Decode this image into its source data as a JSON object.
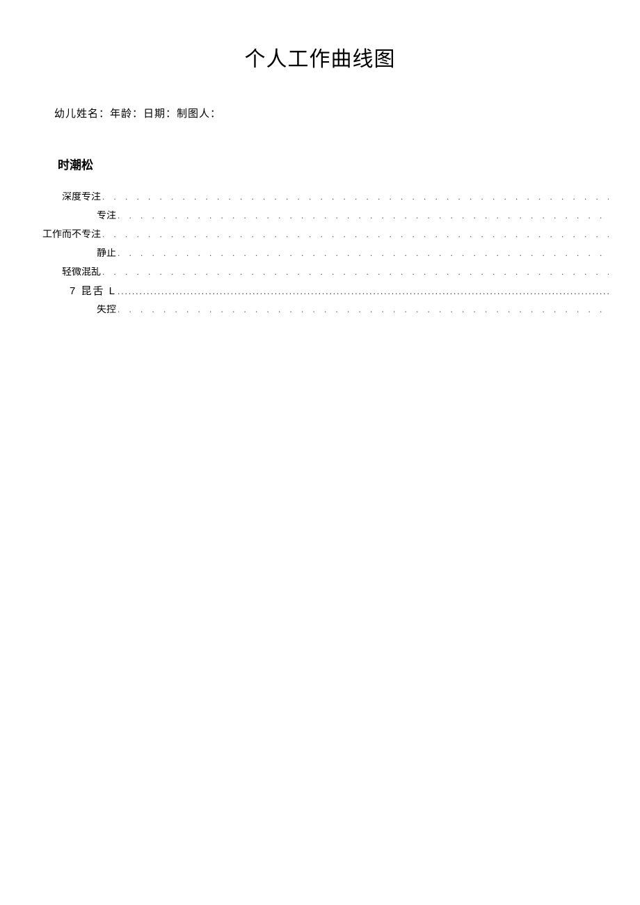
{
  "title": "个人工作曲线图",
  "info": {
    "name_label": "幼儿姓名：",
    "age_label": "年龄：",
    "date_label": "日期：",
    "author_label": "制图人："
  },
  "section_label": "时潮松",
  "levels": [
    {
      "label": "深度专注",
      "style": "w-deep",
      "dot": "normal"
    },
    {
      "label": "专注",
      "style": "w-focus",
      "dot": "normal"
    },
    {
      "label": "工作而不专注",
      "style": "w-work",
      "dot": "normal"
    },
    {
      "label": "静止",
      "style": "w-still",
      "dot": "normal"
    },
    {
      "label": "轻微混乱",
      "style": "w-mild",
      "dot": "normal"
    },
    {
      "label": "7 昆舌 L",
      "style": "w-confused",
      "dot": "tight",
      "labelClass": "confused-label"
    },
    {
      "label": "失控",
      "style": "w-loss",
      "dot": "normal"
    }
  ],
  "dot_string": ". . . . . . . . . . . . . . . . . . . . . . . . . . . . . . . . . . . . . . . . . . . . . . . . . . . . . . . . . . . . . . . . . . . . . . . . . . . . . . . . . . . . . . . . . . . . . . . . . . . . . . . . . . . . . . . . . . . . . . . . . . . . . . . . . . . . . . . . . . . . . . . . . . . . . . . . . . . . . . . . . . . . . . . .",
  "dot_string_tight": "........................................................................................................................................................................................................................................................................................................................................................"
}
